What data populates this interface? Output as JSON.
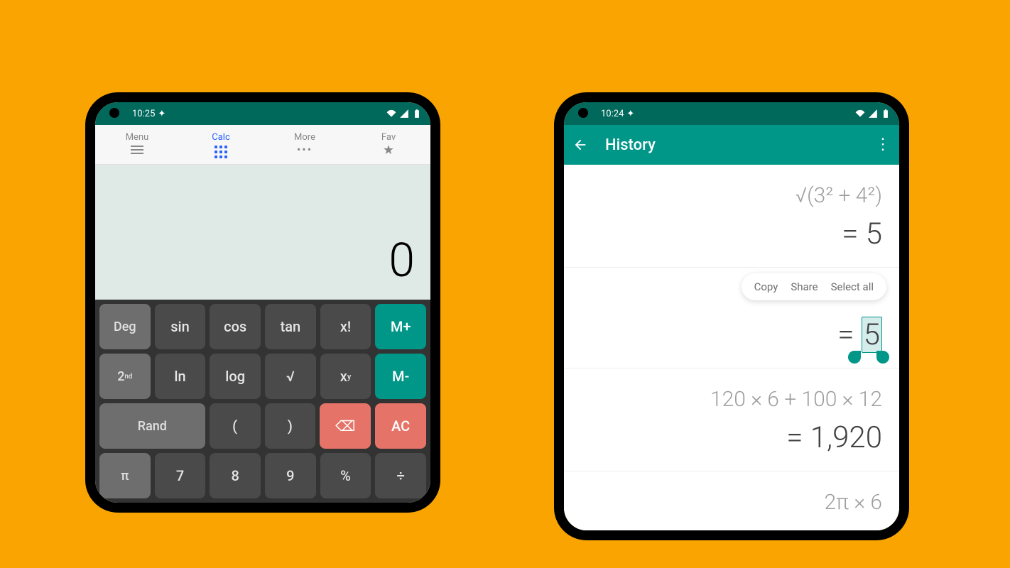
{
  "statusbar": {
    "time": "10:25",
    "time2": "10:24"
  },
  "calc": {
    "tabs": [
      {
        "label": "Menu"
      },
      {
        "label": "Calc"
      },
      {
        "label": "More"
      },
      {
        "label": "Fav"
      }
    ],
    "display": "0",
    "rows": [
      [
        {
          "label": "Deg",
          "cls": "lt"
        },
        {
          "label": "sin"
        },
        {
          "label": "cos"
        },
        {
          "label": "tan"
        },
        {
          "label": "x!"
        },
        {
          "label": "M+",
          "cls": "teal"
        }
      ],
      [
        {
          "html": "2<sup>nd</sup>",
          "cls": "lt"
        },
        {
          "label": "ln"
        },
        {
          "label": "log"
        },
        {
          "label": "√"
        },
        {
          "html": "x<sup>y</sup>"
        },
        {
          "label": "M-",
          "cls": "teal"
        }
      ],
      [
        {
          "label": "Rand",
          "cls": "lt wide"
        },
        {
          "label": "("
        },
        {
          "label": ")"
        },
        {
          "label": "⌫",
          "cls": "red"
        },
        {
          "label": "AC",
          "cls": "red"
        }
      ],
      [
        {
          "label": "π",
          "cls": "lt"
        },
        {
          "label": "7"
        },
        {
          "label": "8"
        },
        {
          "label": "9"
        },
        {
          "label": "%"
        },
        {
          "label": "÷"
        }
      ]
    ]
  },
  "history": {
    "title": "History",
    "actions": {
      "copy": "Copy",
      "share": "Share",
      "select_all": "Select all"
    },
    "items": [
      {
        "expr": "√(3² + 4²)",
        "result": "= 5"
      },
      {
        "expr": "",
        "result_prefix": "= ",
        "result_sel": "5",
        "selected": true
      },
      {
        "expr": "120 × 6 + 100 × 12",
        "result": "= 1,920"
      },
      {
        "expr": "2π × 6",
        "result": ""
      }
    ]
  }
}
